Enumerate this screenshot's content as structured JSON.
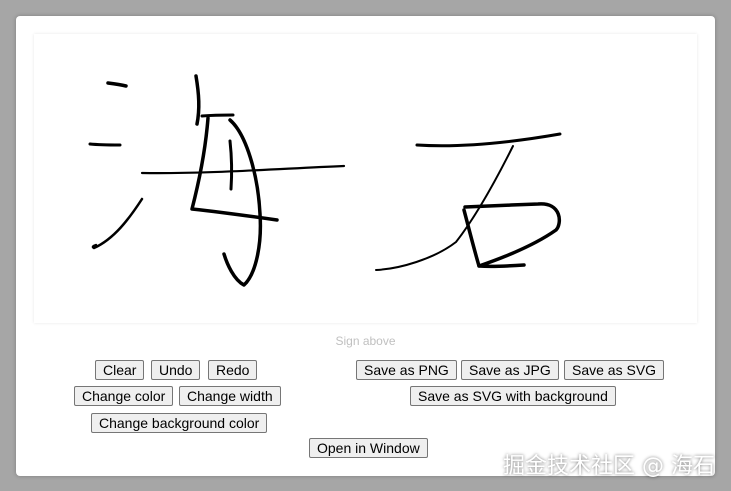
{
  "signature_pad": {
    "label": "Sign above",
    "pen_color": "#000000",
    "background_color": "#ffffff"
  },
  "buttons": {
    "clear": "Clear",
    "undo": "Undo",
    "redo": "Redo",
    "change_color": "Change color",
    "change_width": "Change width",
    "change_background_color": "Change background color",
    "save_png": "Save as PNG",
    "save_jpg": "Save as JPG",
    "save_svg": "Save as SVG",
    "save_svg_background": "Save as SVG with background",
    "open_window": "Open in Window"
  },
  "watermark": "掘金技术社区 @ 海石"
}
